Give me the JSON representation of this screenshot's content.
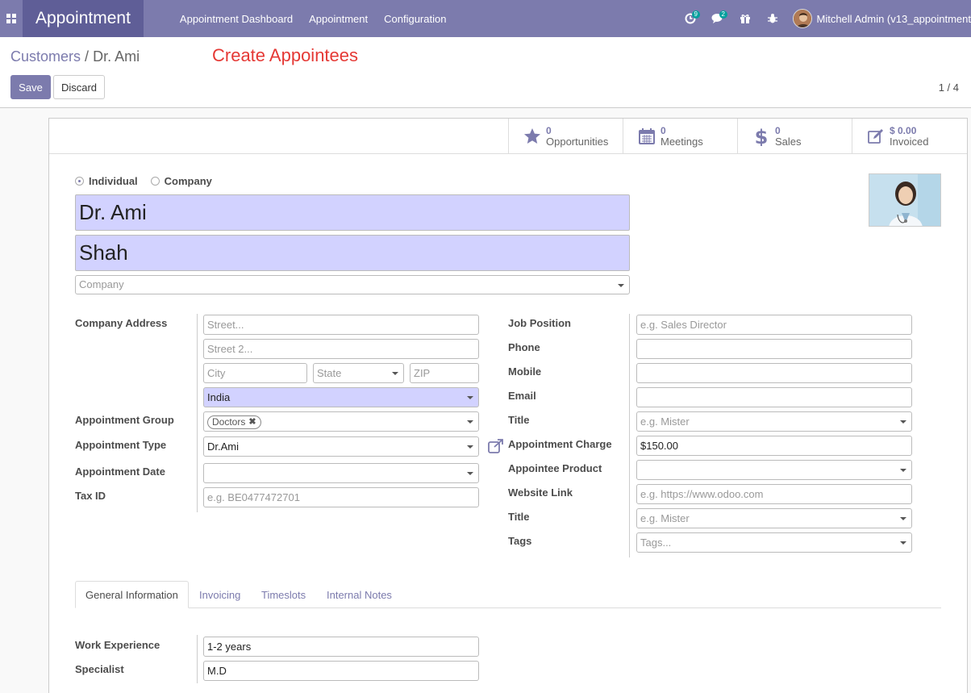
{
  "navbar": {
    "app_name": "Appointment",
    "menu": [
      "Appointment Dashboard",
      "Appointment",
      "Configuration"
    ],
    "activity_badge": "9",
    "messages_badge": "2",
    "user_name": "Mitchell Admin (v13_appointment"
  },
  "control": {
    "breadcrumb_parent": "Customers",
    "breadcrumb_sep": "/",
    "breadcrumb_current": "Dr. Ami",
    "annotation": "Create Appointees",
    "save_label": "Save",
    "discard_label": "Discard",
    "pager": "1 / 4"
  },
  "stats": [
    {
      "value": "0",
      "label": "Opportunities",
      "icon": "star-icon"
    },
    {
      "value": "0",
      "label": "Meetings",
      "icon": "calendar-icon"
    },
    {
      "value": "0",
      "label": "Sales",
      "icon": "dollar-icon"
    },
    {
      "value": "$ 0.00",
      "label": "Invoiced",
      "icon": "edit-icon"
    }
  ],
  "company_type": {
    "individual": "Individual",
    "company": "Company",
    "selected": "Individual"
  },
  "name": {
    "first": "Dr. Ami",
    "last": "Shah",
    "company_placeholder": "Company"
  },
  "left": {
    "company_address_label": "Company Address",
    "street_ph": "Street...",
    "street2_ph": "Street 2...",
    "city_ph": "City",
    "state_ph": "State",
    "zip_ph": "ZIP",
    "country": "India",
    "group_label": "Appointment Group",
    "group_tag": "Doctors",
    "type_label": "Appointment Type",
    "type_value": "Dr.Ami",
    "date_label": "Appointment Date",
    "tax_label": "Tax ID",
    "tax_ph": "e.g. BE0477472701"
  },
  "right": {
    "job_label": "Job Position",
    "job_ph": "e.g. Sales Director",
    "phone_label": "Phone",
    "mobile_label": "Mobile",
    "email_label": "Email",
    "title_label": "Title",
    "title_ph": "e.g. Mister",
    "charge_label": "Appointment Charge",
    "charge_value": "$150.00",
    "product_label": "Appointee Product",
    "website_label": "Website Link",
    "website_ph": "e.g. https://www.odoo.com",
    "title2_label": "Title",
    "title2_ph": "e.g. Mister",
    "tags_label": "Tags",
    "tags_ph": "Tags..."
  },
  "tabs": [
    "General Information",
    "Invoicing",
    "Timeslots",
    "Internal Notes"
  ],
  "general": {
    "experience_label": "Work Experience",
    "experience_value": "1-2 years",
    "specialist_label": "Specialist",
    "specialist_value": "M.D"
  }
}
